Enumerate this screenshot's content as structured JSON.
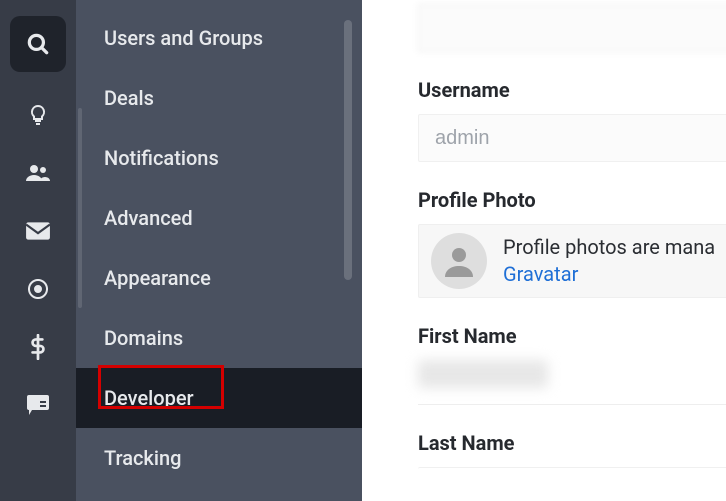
{
  "icon_rail": {
    "items": [
      {
        "name": "search-icon"
      },
      {
        "name": "lightbulb-icon"
      },
      {
        "name": "people-icon"
      },
      {
        "name": "mail-icon"
      },
      {
        "name": "settings-gear-icon"
      },
      {
        "name": "dollar-icon"
      },
      {
        "name": "chat-icon"
      }
    ]
  },
  "sidebar": {
    "items": [
      {
        "label": "Users and Groups"
      },
      {
        "label": "Deals"
      },
      {
        "label": "Notifications"
      },
      {
        "label": "Advanced"
      },
      {
        "label": "Appearance"
      },
      {
        "label": "Domains"
      },
      {
        "label": "Developer",
        "active": true
      },
      {
        "label": "Tracking"
      }
    ]
  },
  "form": {
    "username_label": "Username",
    "username_value": "admin",
    "profile_photo_label": "Profile Photo",
    "profile_photo_text": "Profile photos are mana",
    "gravatar_link_text": "Gravatar",
    "first_name_label": "First Name",
    "last_name_label": "Last Name"
  },
  "highlight": {
    "target": "Developer"
  }
}
